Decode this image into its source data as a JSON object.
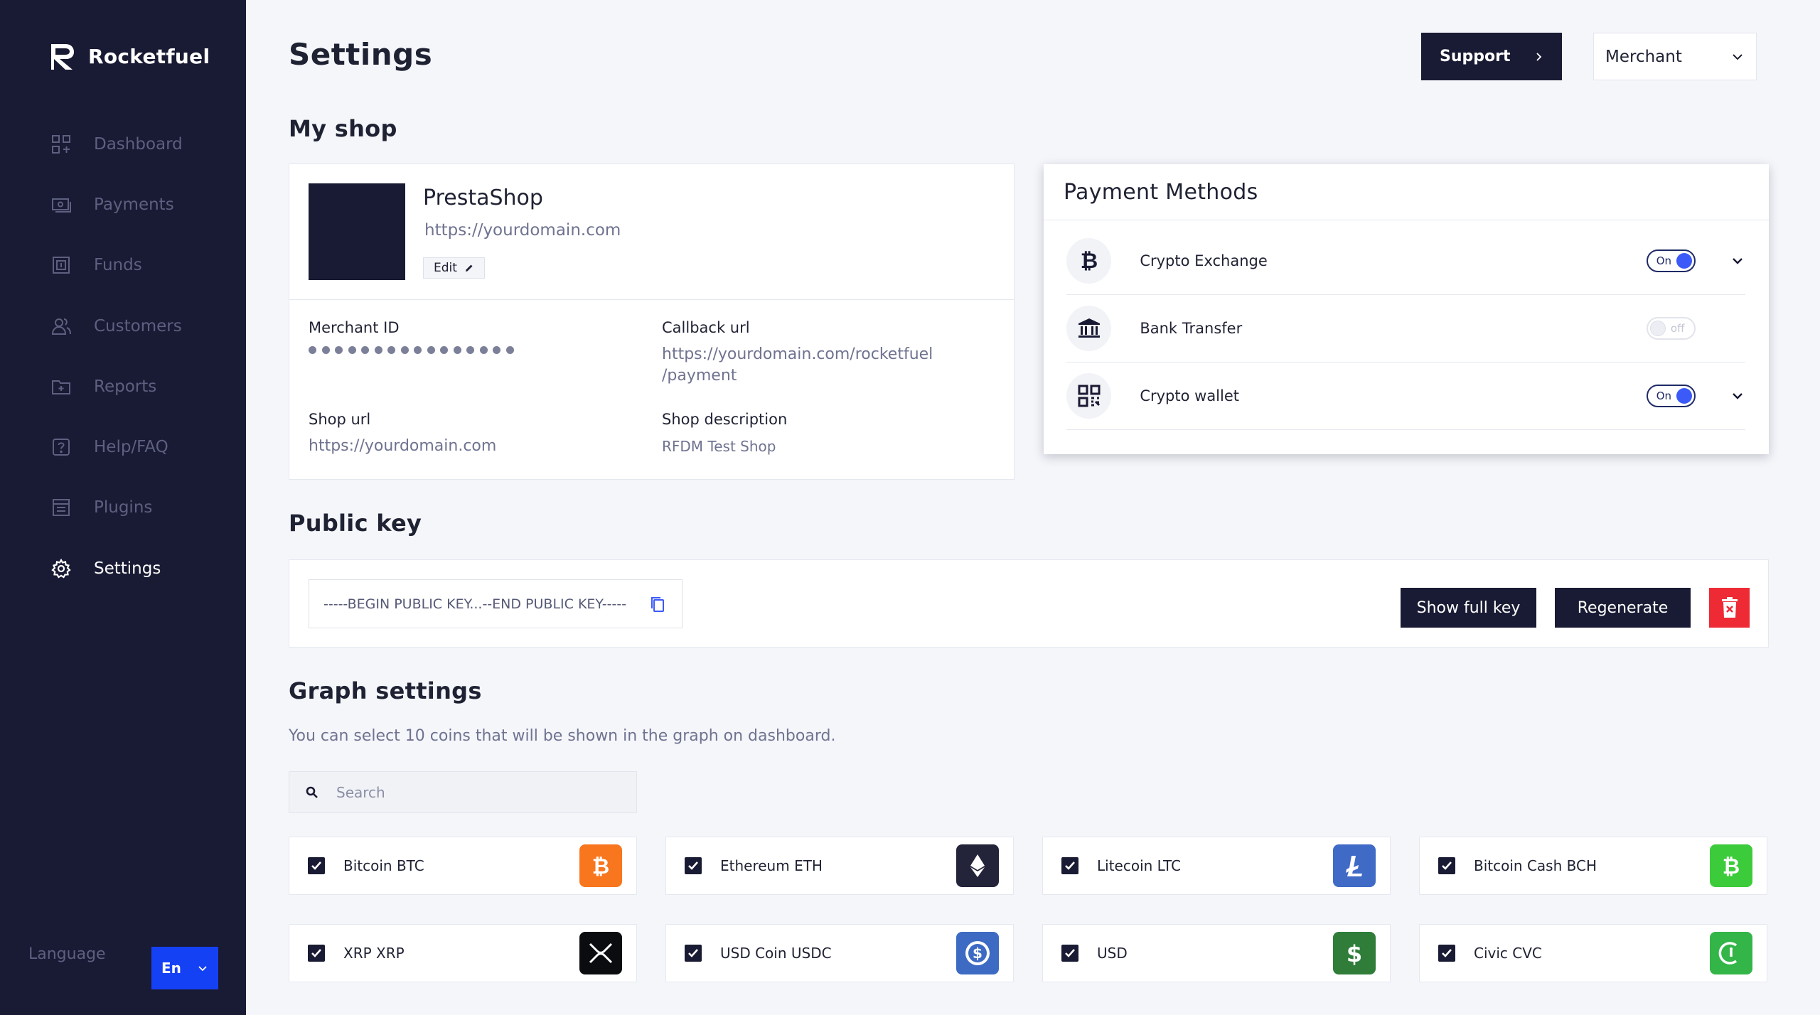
{
  "app": {
    "name": "Rocketfuel"
  },
  "sidebar": {
    "items": [
      {
        "label": "Dashboard",
        "icon": "dashboard-icon",
        "active": false
      },
      {
        "label": "Payments",
        "icon": "payments-icon",
        "active": false
      },
      {
        "label": "Funds",
        "icon": "funds-icon",
        "active": false
      },
      {
        "label": "Customers",
        "icon": "customers-icon",
        "active": false
      },
      {
        "label": "Reports",
        "icon": "reports-icon",
        "active": false
      },
      {
        "label": "Help/FAQ",
        "icon": "help-icon",
        "active": false
      },
      {
        "label": "Plugins",
        "icon": "plugins-icon",
        "active": false
      },
      {
        "label": "Settings",
        "icon": "gear-icon",
        "active": true
      }
    ],
    "language_label": "Language",
    "language_value": "En"
  },
  "header": {
    "title": "Settings",
    "support_label": "Support",
    "role_value": "Merchant"
  },
  "my_shop": {
    "section_title": "My shop",
    "shop_name": "PrestaShop",
    "shop_domain": "https://yourdomain.com",
    "edit_label": "Edit",
    "merchant_id_label": "Merchant ID",
    "callback_label": "Callback url",
    "callback_value_line1": "https://yourdomain.com/rocketfuel",
    "callback_value_line2": "/payment",
    "shop_url_label": "Shop url",
    "shop_url_value": "https://yourdomain.com",
    "shop_desc_label": "Shop description",
    "shop_desc_value": "RFDM Test Shop"
  },
  "payment_methods": {
    "title": "Payment Methods",
    "items": [
      {
        "label": "Crypto Exchange",
        "icon": "bitcoin-icon",
        "toggle": "On",
        "enabled": true
      },
      {
        "label": "Bank Transfer",
        "icon": "bank-icon",
        "toggle": "off",
        "enabled": false
      },
      {
        "label": "Crypto wallet",
        "icon": "qr-code-icon",
        "toggle": "On",
        "enabled": true
      }
    ]
  },
  "public_key": {
    "section_title": "Public key",
    "value": "-----BEGIN PUBLIC KEY...--END PUBLIC KEY-----",
    "show_full_label": "Show full key",
    "regenerate_label": "Regenerate"
  },
  "graph_settings": {
    "section_title": "Graph settings",
    "description": "You can select 10 coins that will be shown in the graph on dashboard.",
    "search_placeholder": "Search",
    "coins": [
      {
        "name": "Bitcoin BTC",
        "checked": true,
        "color": "#f7761e",
        "icon": "bitcoin-icon"
      },
      {
        "name": "Ethereum ETH",
        "checked": true,
        "color": "#23243a",
        "icon": "ethereum-icon"
      },
      {
        "name": "Litecoin LTC",
        "checked": true,
        "color": "#3f6bc6",
        "icon": "litecoin-icon"
      },
      {
        "name": "Bitcoin Cash BCH",
        "checked": true,
        "color": "#3ccb3a",
        "icon": "bitcoin-cash-icon"
      },
      {
        "name": "XRP XRP",
        "checked": true,
        "color": "#0b0c10",
        "icon": "xrp-icon"
      },
      {
        "name": "USD Coin USDC",
        "checked": true,
        "color": "#3d6bc3",
        "icon": "usdc-icon"
      },
      {
        "name": "USD",
        "checked": true,
        "color": "#2f7d39",
        "icon": "dollar-icon"
      },
      {
        "name": "Civic CVC",
        "checked": true,
        "color": "#33b548",
        "icon": "civic-icon"
      }
    ]
  }
}
